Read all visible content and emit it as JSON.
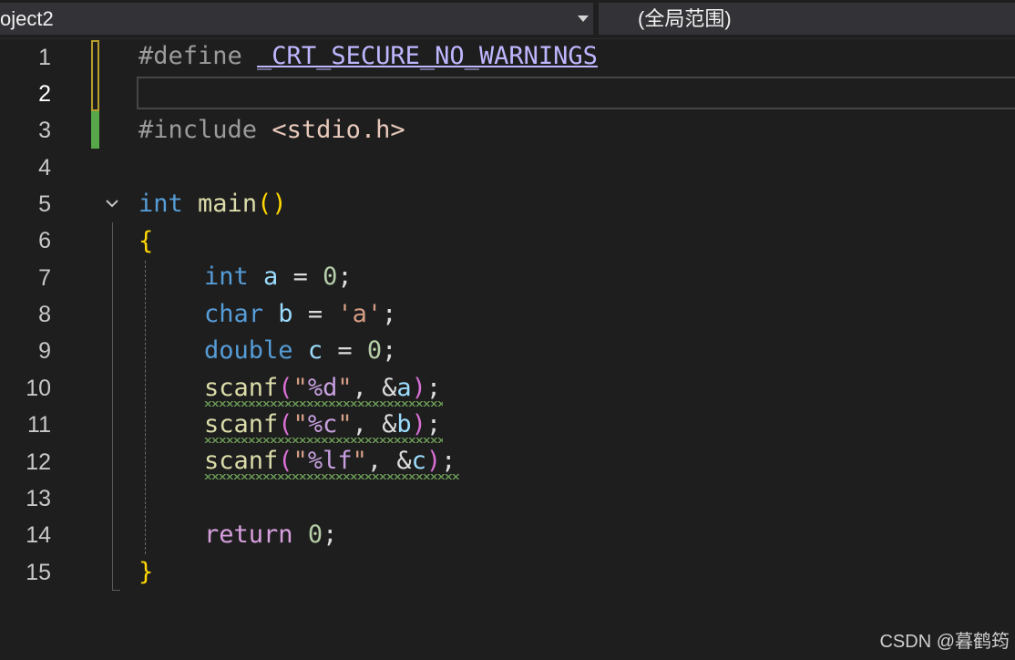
{
  "navbar": {
    "project": "oject2",
    "scope": "(全局范围)"
  },
  "line_numbers": [
    "1",
    "2",
    "3",
    "4",
    "5",
    "6",
    "7",
    "8",
    "9",
    "10",
    "11",
    "12",
    "13",
    "14",
    "15"
  ],
  "code": {
    "l1": {
      "a": "#define ",
      "b": "_CRT_SECURE_NO_WARNINGS"
    },
    "l3": {
      "a": "#include ",
      "b": "<stdio.h>"
    },
    "l5": {
      "kw": "int",
      "sp": " ",
      "fn": "main",
      "p": "()"
    },
    "l6": {
      "brace": "{"
    },
    "l7": {
      "kw": "int",
      "sp": " ",
      "v": "a",
      "eq": " = ",
      "n": "0",
      "e": ";"
    },
    "l8": {
      "kw": "char",
      "sp": " ",
      "v": "b",
      "eq": " = ",
      "s": "'a'",
      "e": ";"
    },
    "l9": {
      "kw": "double",
      "sp": " ",
      "v": "c",
      "eq": " = ",
      "n": "0",
      "e": ";"
    },
    "l10": {
      "fn": "scanf",
      "po": "(",
      "s1": "\"",
      "f": "%d",
      "s2": "\"",
      "c": ", &",
      "v": "a",
      "pc": ")",
      "e": ";"
    },
    "l11": {
      "fn": "scanf",
      "po": "(",
      "s1": "\"",
      "f": "%c",
      "s2": "\"",
      "c": ", &",
      "v": "b",
      "pc": ")",
      "e": ";"
    },
    "l12": {
      "fn": "scanf",
      "po": "(",
      "s1": "\"",
      "f": "%lf",
      "s2": "\"",
      "c": ", &",
      "v": "c",
      "pc": ")",
      "e": ";"
    },
    "l14": {
      "kw": "return",
      "sp": " ",
      "n": "0",
      "e": ";"
    },
    "l15": {
      "brace": "}"
    }
  },
  "current_line": "2",
  "watermark": "CSDN @暮鹤筠",
  "colors": {
    "background": "#1e1e1e",
    "keyword": "#569cd6",
    "function": "#dcdcaa",
    "variable": "#9cdcfe",
    "number": "#b5cea8",
    "string": "#d69d85",
    "macro": "#beb7ff",
    "change_saved": "#57a64a",
    "change_unsaved": "#b59e2c"
  }
}
